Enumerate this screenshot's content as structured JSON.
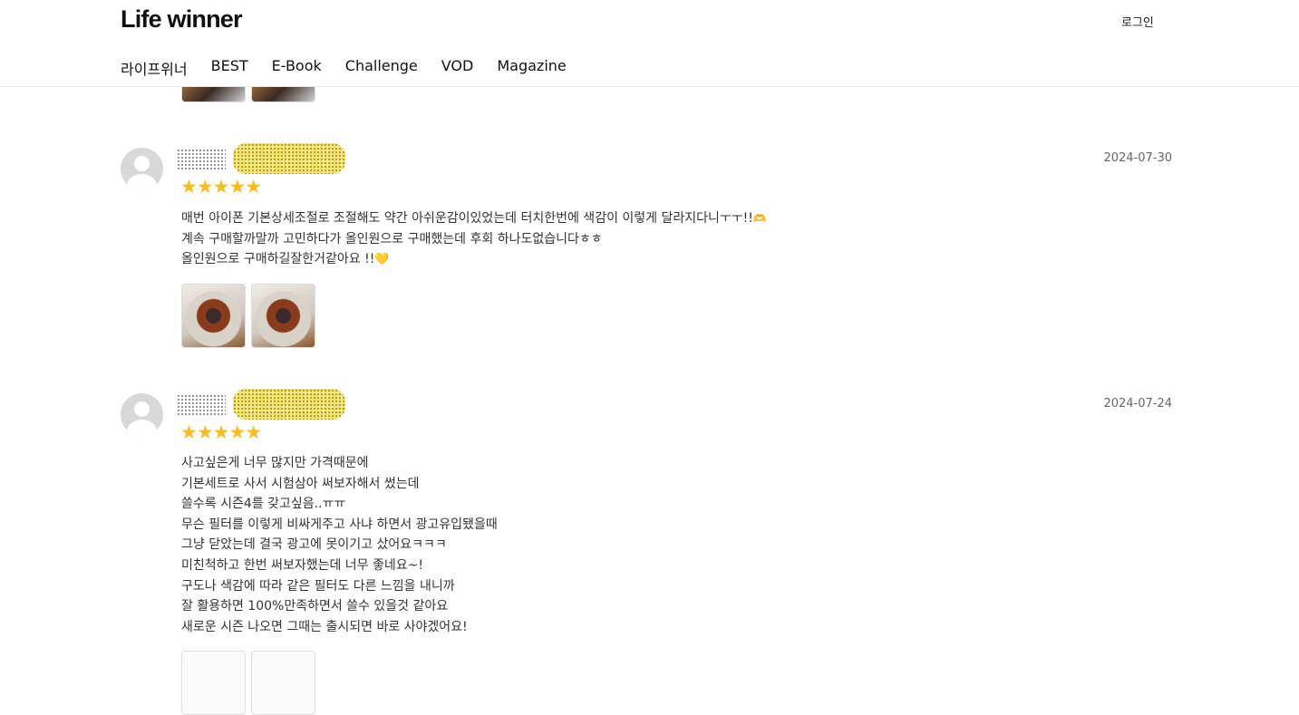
{
  "header": {
    "logo": "Life winner",
    "login": "로그인",
    "nav": [
      "라이프위너",
      "BEST",
      "E-Book",
      "Challenge",
      "VOD",
      "Magazine"
    ]
  },
  "reviews": [
    {
      "date": "2024-07-30",
      "rating": 5,
      "stars": "★★★★★",
      "lines": [
        "매번 아이폰 기본상세조절로 조절해도 약간 아쉬운감이있었는데 터치한번에 색감이 이렇게 달라지다니ㅜㅜ!!",
        "계속 구매할까말까 고민하다가 올인원으로 구매했는데 후회 하나도없습니다ㅎㅎ",
        "올인원으로 구매하길잘한거같아요 !!"
      ],
      "emoji_hands": "🫶",
      "emoji_heart": "💛"
    },
    {
      "date": "2024-07-24",
      "rating": 5,
      "stars": "★★★★★",
      "lines": [
        "사고싶은게 너무 많지만 가격때문에",
        "기본세트로 사서 시험삼아 써보자해서 썼는데",
        "쓸수록 시즌4를 갖고싶음..ㅠㅠ",
        "무슨 필터를 이렇게 비싸게주고 사냐 하면서 광고유입됐을때",
        "그냥 닫았는데 결국 광고에 못이기고 샀어요ㅋㅋㅋ",
        "미친척하고 한번 써보자했는데 너무 좋네요~!",
        "구도나 색감에 따라 같은 필터도 다른 느낌을 내니까",
        "잘 활용하면 100%만족하면서 쓸수 있을것 같아요",
        "새로운 시즌 나오면 그때는 출시되면 바로 사야겠어요!"
      ]
    }
  ]
}
